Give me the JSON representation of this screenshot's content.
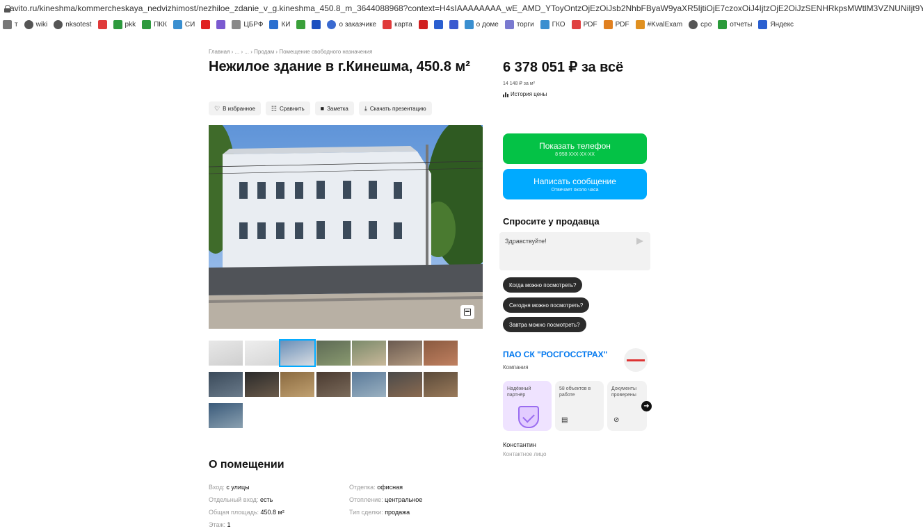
{
  "browser": {
    "url": "avito.ru/kineshma/kommercheskaya_nedvizhimost/nezhiloe_zdanie_v_g.kineshma_450.8_m_3644088968?context=H4sIAAAAAAAA_wE_AMD_YToyOntzOjEzOiJsb2NhbFByaW9yaXR5IjtiOjE7czoxOiJ4IjtzOjE2OiJzSENHRkpsMWtlM3VZNUNiIjt9Yo8...",
    "bookmarks": [
      {
        "label": "т",
        "icon": "bookmark-icon",
        "color": "#777777"
      },
      {
        "label": "wiki",
        "icon": "globe-icon",
        "color": "#555555"
      },
      {
        "label": "nksotest",
        "icon": "globe-icon",
        "color": "#555555"
      },
      {
        "label": "",
        "icon": "red-app-icon",
        "color": "#e03a3a"
      },
      {
        "label": "pkk",
        "icon": "map-icon",
        "color": "#2e9a3e"
      },
      {
        "label": "ПКК",
        "icon": "map-icon",
        "color": "#2e9a3e"
      },
      {
        "label": "СИ",
        "icon": "app-icon",
        "color": "#3a8fd0"
      },
      {
        "label": "",
        "icon": "star-icon",
        "color": "#e02020"
      },
      {
        "label": "",
        "icon": "app-icon",
        "color": "#7a5ad0"
      },
      {
        "label": "ЦБРФ",
        "icon": "bank-icon",
        "color": "#888888"
      },
      {
        "label": "КИ",
        "icon": "chart-icon",
        "color": "#2a6fd0"
      },
      {
        "label": "",
        "icon": "app-icon",
        "color": "#3aa03a"
      },
      {
        "label": "",
        "icon": "app-icon",
        "color": "#1a4fc0"
      },
      {
        "label": "о заказчике",
        "icon": "globe-icon",
        "color": "#3a6ad0"
      },
      {
        "label": "карта",
        "icon": "map-pin-icon",
        "color": "#e03a3a"
      },
      {
        "label": "",
        "icon": "app-icon",
        "color": "#d02020"
      },
      {
        "label": "",
        "icon": "app-icon",
        "color": "#2a5fd0"
      },
      {
        "label": "",
        "icon": "app-icon",
        "color": "#3a5ad0"
      },
      {
        "label": "о доме",
        "icon": "home-icon",
        "color": "#3a8fd0"
      },
      {
        "label": "торги",
        "icon": "app-icon",
        "color": "#7a7ad0"
      },
      {
        "label": "ГКО",
        "icon": "app-icon",
        "color": "#3a8fd0"
      },
      {
        "label": "PDF",
        "icon": "pdf-icon",
        "color": "#e04040"
      },
      {
        "label": "PDF",
        "icon": "pdf-icon",
        "color": "#e08020"
      },
      {
        "label": "#KvalExam",
        "icon": "app-icon",
        "color": "#e09020"
      },
      {
        "label": "сро",
        "icon": "globe-icon",
        "color": "#555555"
      },
      {
        "label": "отчеты",
        "icon": "app-icon",
        "color": "#2a9a3a"
      },
      {
        "label": "Яндекс",
        "icon": "app-icon",
        "color": "#2a5fd0"
      }
    ]
  },
  "breadcrumbs": "Главная › ... › ... › Продам › Помещение свободного назначения",
  "listing": {
    "title": "Нежилое здание в г.Кинешма, 450.8 м²",
    "actions": [
      {
        "label": "В избранное",
        "icon": "heart-icon"
      },
      {
        "label": "Сравнить",
        "icon": "compare-icon"
      },
      {
        "label": "Заметка",
        "icon": "note-icon"
      },
      {
        "label": "Скачать презентацию",
        "icon": "download-icon"
      }
    ],
    "thumbnail_count": 15
  },
  "about": {
    "title": "О помещении",
    "params": [
      {
        "key": "Вход: ",
        "value": "с улицы"
      },
      {
        "key": "Отдельный вход: ",
        "value": "есть"
      },
      {
        "key": "Общая площадь: ",
        "value": "450.8 м²"
      },
      {
        "key": "Этаж: ",
        "value": "1"
      },
      {
        "key": "Отделка: ",
        "value": "офисная"
      },
      {
        "key": "Отопление: ",
        "value": "центральное"
      },
      {
        "key": "Тип сделки: ",
        "value": "продажа"
      }
    ]
  },
  "price": {
    "total": "6 378 051 ₽ за всё",
    "per_m2": "14 148 ₽ за м²",
    "history_label": "История цены"
  },
  "contact_buttons": {
    "phone_label": "Показать телефон",
    "phone_sub": "8 958 XXX-XX-XX",
    "message_label": "Написать сообщение",
    "message_sub": "Отвечает около часа"
  },
  "ask_seller": {
    "title": "Спросите у продавца",
    "input_value": "Здравствуйте!",
    "quick_questions": [
      "Когда можно посмотреть?",
      "Сегодня можно посмотреть?",
      "Завтра можно посмотреть?"
    ]
  },
  "seller": {
    "company": "ПАО СК \"РОСГОССТРАХ\"",
    "type": "Компания",
    "badges": [
      {
        "label": "Надёжный партнёр",
        "icon": "shield-check-icon"
      },
      {
        "label": "58 объектов в работе",
        "icon": "note-icon"
      },
      {
        "label": "Документы проверены",
        "icon": "check-circle-icon"
      }
    ],
    "contact_name": "Константин",
    "contact_role": "Контактное лицо"
  },
  "colors": {
    "phone_button": "#04c246",
    "message_button": "#00aaff",
    "company_link": "#0077ee",
    "chip_bg": "#2b2b2b"
  }
}
